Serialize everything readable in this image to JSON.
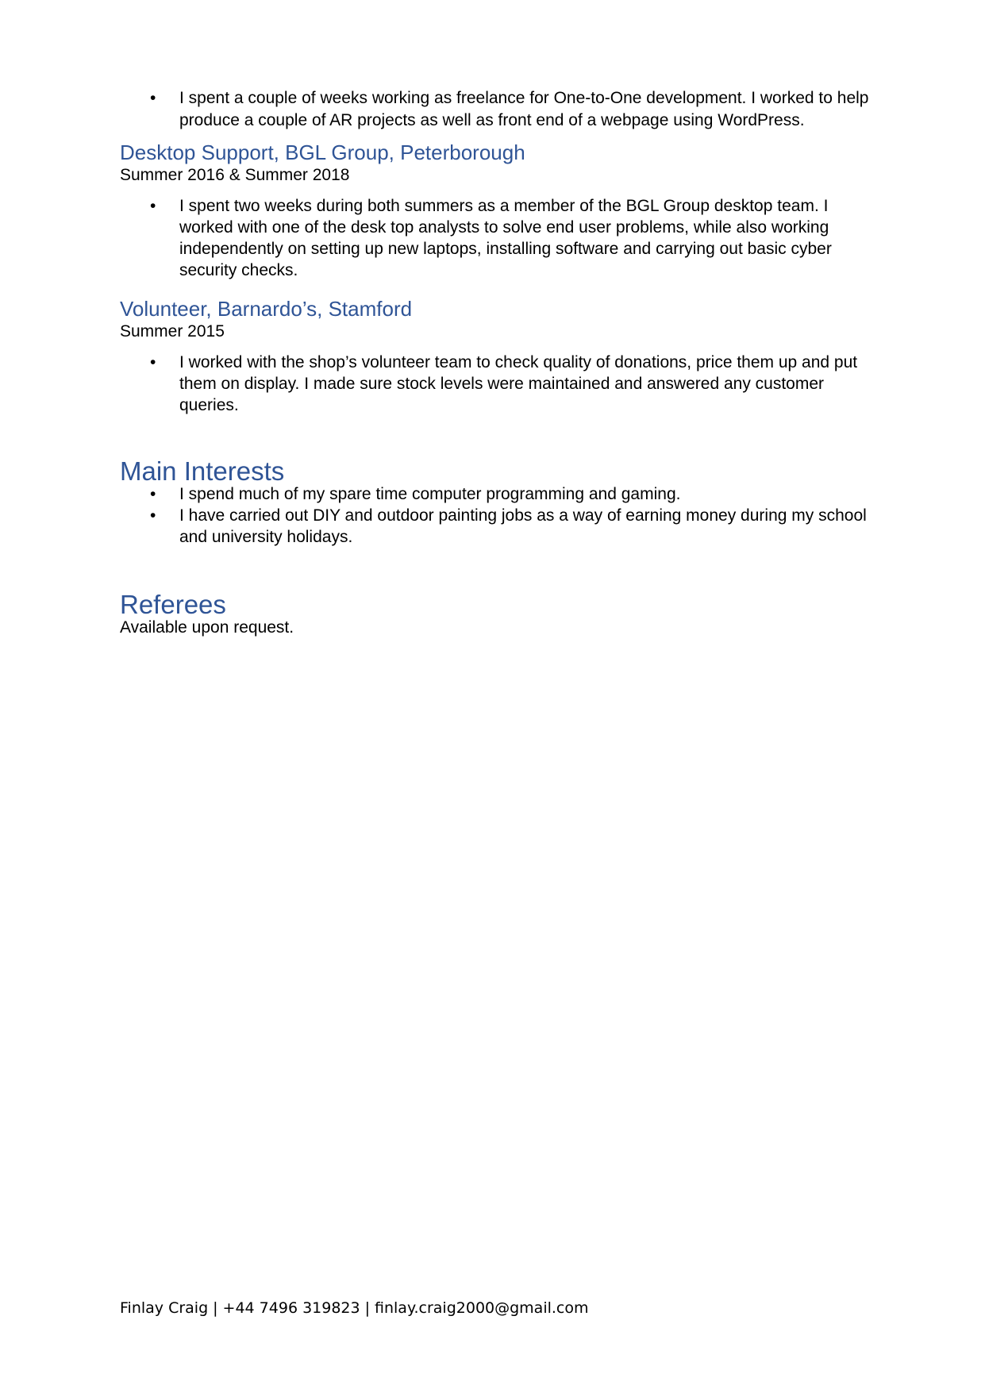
{
  "document": {
    "intro_bullets": [
      "I spent a couple of weeks working as freelance for One-to-One development. I worked to help produce a couple of AR projects as well as front end of a webpage using WordPress."
    ],
    "jobs": [
      {
        "title": "Desktop Support, BGL Group, Peterborough",
        "dates": "Summer 2016 & Summer 2018",
        "bullets": [
          "I spent two weeks during both summers as a member of the BGL Group desktop team.  I worked with one of the desk top analysts to solve end user problems, while also working independently on setting up new laptops, installing software and carrying out basic cyber security checks."
        ]
      },
      {
        "title": "Volunteer, Barnardo’s, Stamford",
        "dates": "Summer 2015",
        "bullets": [
          "I worked with the shop’s volunteer team to check quality of donations, price them up and put them on display. I made sure stock levels were maintained and answered any customer queries."
        ]
      }
    ],
    "interests": {
      "heading": "Main Interests",
      "bullets": [
        "I spend much of my spare time computer programming and gaming.",
        "I have carried out DIY and outdoor painting jobs as a way of earning money during my school and university holidays."
      ]
    },
    "referees": {
      "heading": "Referees",
      "text": "Available upon request."
    },
    "footer": {
      "name": "Finlay Craig",
      "phone": "+44 7496 319823",
      "email": "finlay.craig2000@gmail.com",
      "separator": "|"
    },
    "bullet_glyph": "•",
    "colors": {
      "heading": "#2f5496",
      "text": "#000000"
    }
  }
}
